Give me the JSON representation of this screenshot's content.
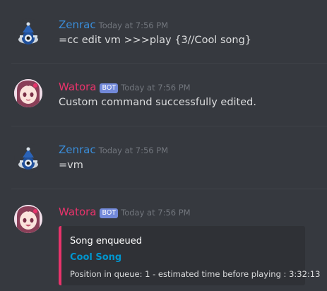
{
  "messages": [
    {
      "author": "Zenrac",
      "timestamp": "Today at 7:56 PM",
      "content": "=cc edit vm >>>play {3//Cool song}",
      "avatar": "teapot-avatar"
    },
    {
      "author": "Watora",
      "bot_tag": "BOT",
      "timestamp": "Today at 7:56 PM",
      "content": "Custom command successfully edited.",
      "avatar": "anime-girl-avatar"
    },
    {
      "author": "Zenrac",
      "timestamp": "Today at 7:56 PM",
      "content": "=vm",
      "avatar": "teapot-avatar"
    },
    {
      "author": "Watora",
      "bot_tag": "BOT",
      "timestamp": "Today at 7:56 PM",
      "avatar": "anime-girl-avatar",
      "embed": {
        "author": "Song enqueued",
        "title": "Cool Song",
        "description": "Position in queue: 1 - estimated time before playing : 3:32:13",
        "color": "#e9336b"
      }
    }
  ],
  "colors": {
    "background": "#36393f",
    "zenrac_name": "#3a8dd9",
    "watora_name": "#e9336b",
    "bot_tag": "#7289da",
    "embed_background": "#2f3136",
    "link": "#0096cf"
  }
}
